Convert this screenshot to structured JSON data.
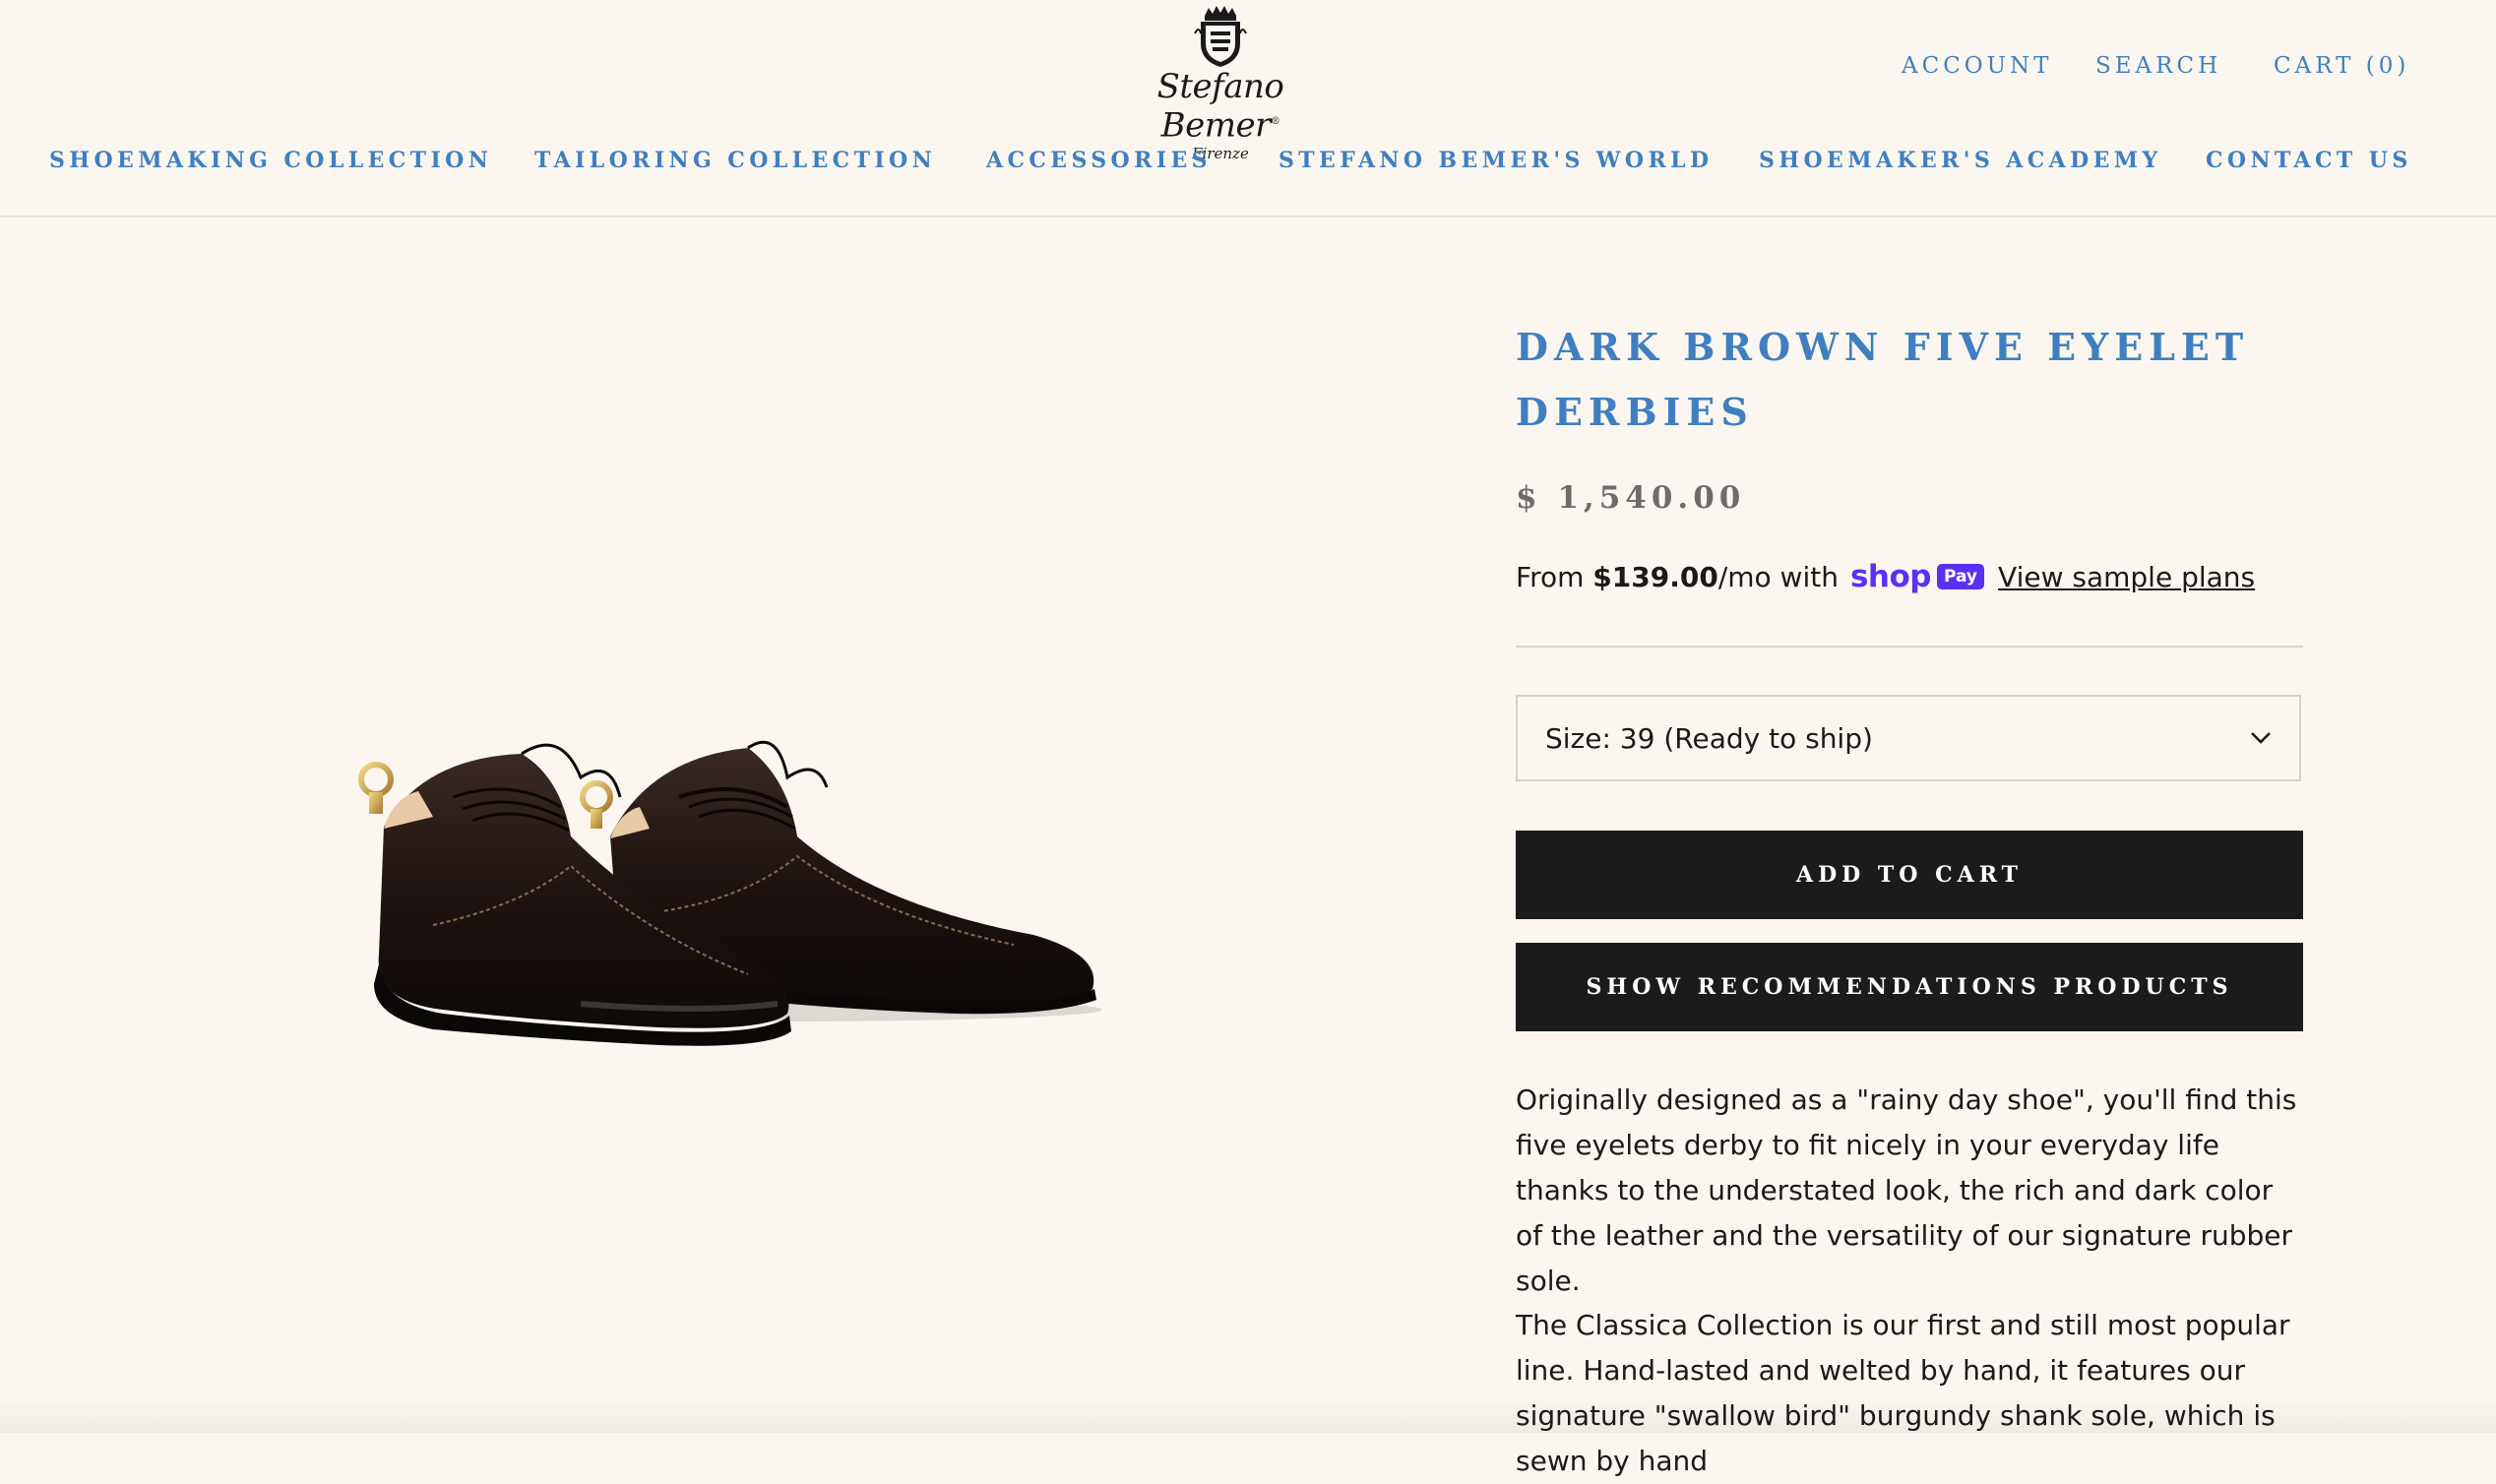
{
  "brand": {
    "name": "Stefano Bemer",
    "city": "Firenze"
  },
  "header": {
    "utility": [
      "ACCOUNT",
      "SEARCH",
      "CART (0)"
    ],
    "nav": [
      "SHOEMAKING COLLECTION",
      "TAILORING COLLECTION",
      "ACCESSORIES",
      "STEFANO BEMER'S WORLD",
      "SHOEMAKER'S ACADEMY",
      "CONTACT US"
    ]
  },
  "product": {
    "title": "DARK BROWN FIVE EYELET DERBIES",
    "price": "$ 1,540.00",
    "installment": {
      "prefix": "From",
      "amount": "$139.00",
      "suffix": "/mo with",
      "provider": "shop",
      "badge": "Pay",
      "link": "View sample plans"
    },
    "size_select": "Size: 39 (Ready to ship)",
    "add_to_cart": "ADD TO CART",
    "recommendations": "SHOW RECOMMENDATIONS PRODUCTS",
    "description": [
      "Originally designed as a \"rainy day shoe\", you'll find this five eyelets derby to fit nicely in your everyday life thanks to the understated look, the rich and dark color of the leather and the versatility of our signature rubber sole.",
      "The Classica Collection is our first and still most popular line. Hand-lasted and welted by hand, it features our signature \"swallow bird\" burgundy shank sole, which is sewn by hand"
    ]
  },
  "colors": {
    "accent": "#3f7fc1",
    "button": "#1b1b1b",
    "background": "#fbf7f0",
    "shop_pay": "#5a31f4"
  }
}
